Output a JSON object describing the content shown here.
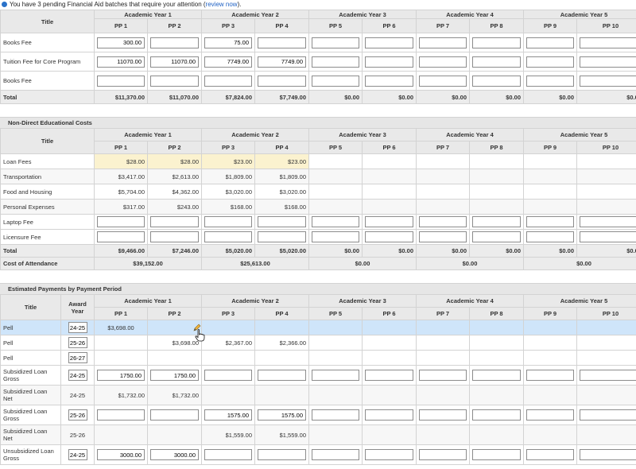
{
  "alert": {
    "text": "You have 3 pending Financial Aid batches that require your attention (",
    "link": "review now",
    "suffix": ")."
  },
  "pp_labels": [
    "PP 1",
    "PP 2",
    "PP 3",
    "PP 4",
    "PP 5",
    "PP 6",
    "PP 7",
    "PP 8",
    "PP 9",
    "PP 10"
  ],
  "year_labels": [
    "Academic Year 1",
    "Academic Year 2",
    "Academic Year 3",
    "Academic Year 4",
    "Academic Year 5"
  ],
  "direct": {
    "title_header": "Title",
    "rows": [
      {
        "label": "Books Fee",
        "cells": [
          "300.00",
          "",
          "75.00",
          "",
          "",
          "",
          "",
          "",
          "",
          ""
        ]
      },
      {
        "label": "Tuition Fee for Core Program",
        "cells": [
          "11070.00",
          "11070.00",
          "7749.00",
          "7749.00",
          "",
          "",
          "",
          "",
          "",
          ""
        ]
      },
      {
        "label": "Books Fee",
        "cells": [
          "",
          "",
          "",
          "",
          "",
          "",
          "",
          "",
          "",
          ""
        ]
      }
    ],
    "total": {
      "label": "Total",
      "cells": [
        "$11,370.00",
        "$11,070.00",
        "$7,824.00",
        "$7,749.00",
        "$0.00",
        "$0.00",
        "$0.00",
        "$0.00",
        "$0.00",
        "$0.00"
      ]
    }
  },
  "nondirect": {
    "section_title": "Non-Direct Educational Costs",
    "title_header": "Title",
    "rows": [
      {
        "label": "Loan Fees",
        "cells": [
          "$28.00",
          "$28.00",
          "$23.00",
          "$23.00",
          "",
          "",
          "",
          "",
          "",
          ""
        ]
      },
      {
        "label": "Transportation",
        "cells": [
          "$3,417.00",
          "$2,613.00",
          "$1,809.00",
          "$1,809.00",
          "",
          "",
          "",
          "",
          "",
          ""
        ]
      },
      {
        "label": "Food and Housing",
        "cells": [
          "$5,704.00",
          "$4,362.00",
          "$3,020.00",
          "$3,020.00",
          "",
          "",
          "",
          "",
          "",
          ""
        ]
      },
      {
        "label": "Personal Expenses",
        "cells": [
          "$317.00",
          "$243.00",
          "$168.00",
          "$168.00",
          "",
          "",
          "",
          "",
          "",
          ""
        ]
      },
      {
        "label": "Laptop Fee",
        "cells": [
          "",
          "",
          "",
          "",
          "",
          "",
          "",
          "",
          "",
          ""
        ]
      },
      {
        "label": "Licensure Fee",
        "cells": [
          "",
          "",
          "",
          "",
          "",
          "",
          "",
          "",
          "",
          ""
        ]
      }
    ],
    "total": {
      "label": "Total",
      "cells": [
        "$9,466.00",
        "$7,246.00",
        "$5,020.00",
        "$5,020.00",
        "$0.00",
        "$0.00",
        "$0.00",
        "$0.00",
        "$0.00",
        "$0.00"
      ]
    },
    "coa": {
      "label": "Cost of Attendance",
      "cells": [
        "$39,152.00",
        "$25,613.00",
        "$0.00",
        "$0.00",
        "$0.00"
      ]
    }
  },
  "payments": {
    "section_title": "Estimated Payments by Payment Period",
    "title_header": "Title",
    "award_year_header": "Award Year",
    "rows": [
      {
        "label": "Pell",
        "year": "24-25",
        "cells": [
          "$3,698.00",
          "",
          "",
          "",
          "",
          "",
          "",
          "",
          "",
          ""
        ]
      },
      {
        "label": "Pell",
        "year": "25-26",
        "cells": [
          "",
          "$3,698.00",
          "$2,367.00",
          "$2,366.00",
          "",
          "",
          "",
          "",
          "",
          ""
        ]
      },
      {
        "label": "Pell",
        "year": "26-27",
        "cells": [
          "",
          "",
          "",
          "",
          "",
          "",
          "",
          "",
          "",
          ""
        ]
      },
      {
        "label": "Subsidized Loan Gross",
        "year": "24-25",
        "cells": [
          "1750.00",
          "1750.00",
          "",
          "",
          "",
          "",
          "",
          "",
          "",
          ""
        ]
      },
      {
        "label": "Subsidized Loan Net",
        "year": "24-25",
        "cells": [
          "$1,732.00",
          "$1,732.00",
          "",
          "",
          "",
          "",
          "",
          "",
          "",
          ""
        ]
      },
      {
        "label": "Subsidized Loan Gross",
        "year": "25-26",
        "cells": [
          "",
          "",
          "1575.00",
          "1575.00",
          "",
          "",
          "",
          "",
          "",
          ""
        ]
      },
      {
        "label": "Subsidized Loan Net",
        "year": "25-26",
        "cells": [
          "",
          "",
          "$1,559.00",
          "$1,559.00",
          "",
          "",
          "",
          "",
          "",
          ""
        ]
      },
      {
        "label": "Unsubsidized Loan Gross",
        "year": "24-25",
        "cells": [
          "3000.00",
          "3000.00",
          "",
          "",
          "",
          "",
          "",
          "",
          "",
          ""
        ]
      }
    ]
  }
}
